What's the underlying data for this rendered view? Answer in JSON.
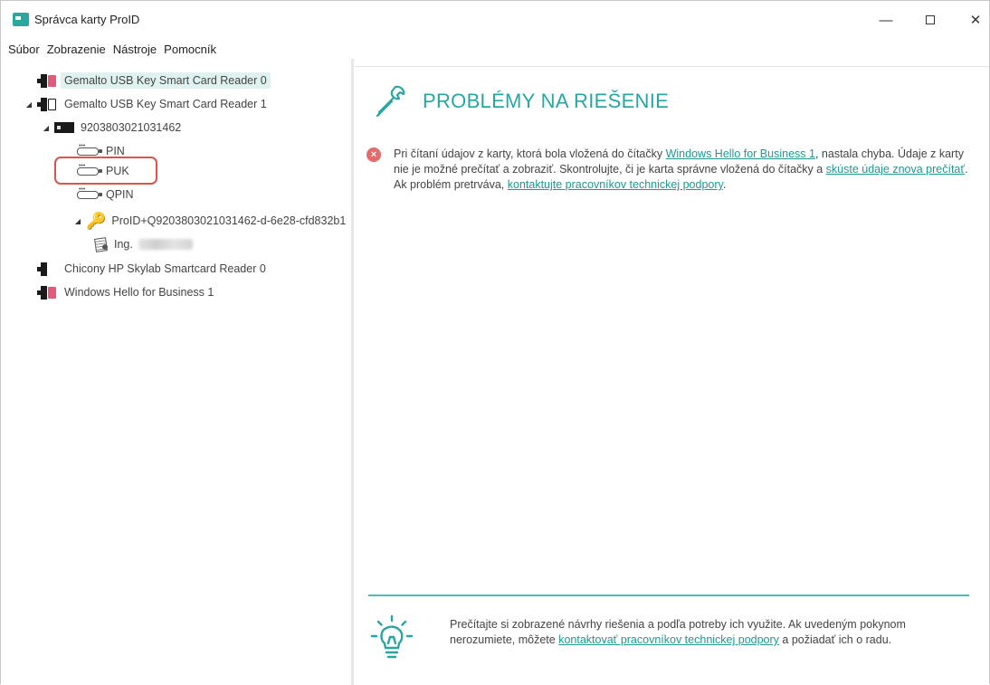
{
  "window": {
    "title": "Správca karty ProID",
    "controls": {
      "minimize": "—",
      "close": "✕"
    }
  },
  "menu": [
    "Súbor",
    "Zobrazenie",
    "Nástroje",
    "Pomocník"
  ],
  "tree": {
    "readers": [
      {
        "label": "Gemalto USB Key Smart Card Reader 0"
      },
      {
        "label": "Gemalto USB Key Smart Card Reader 1"
      },
      {
        "label": "Chicony HP Skylab Smartcard Reader 0"
      },
      {
        "label": "Windows Hello for Business 1"
      }
    ],
    "card": {
      "label": "9203803021031462"
    },
    "pins": [
      "PIN",
      "PUK",
      "QPIN"
    ],
    "container": {
      "label": "ProID+Q9203803021031462-d-6e28-cfd832b1"
    },
    "certificate": {
      "label": "Ing."
    },
    "colors": {
      "selected_bg": "#dff2ef",
      "card_pink": "#e35a7a",
      "highlight": "#d9534f"
    }
  },
  "problem": {
    "title": "PROBLÉMY NA RIEŠENIE",
    "message": {
      "part1": "Pri čítaní údajov z karty, ktorá bola vložená do čítačky ",
      "link1": "Windows Hello for Business 1",
      "part2": ", nastala chyba. Údaje z karty nie je možné prečítať a zobraziť. Skontrolujte, či je karta správne vložená do čítačky a ",
      "link2": "skúste údaje znova prečítať",
      "part3": ". Ak problém pretrváva, ",
      "link3": "kontaktujte pracovníkov technickej podpory",
      "part4": "."
    },
    "accent_color": "#2aa6a0",
    "error_color": "#e36b6b"
  },
  "tip": {
    "part1": "Prečítajte si zobrazené návrhy riešenia a podľa potreby ich využite. Ak uvedeným pokynom nerozumiete, môžete ",
    "link": "kontaktovať pracovníkov technickej podpory",
    "part2": " a požiadať ich o radu."
  }
}
